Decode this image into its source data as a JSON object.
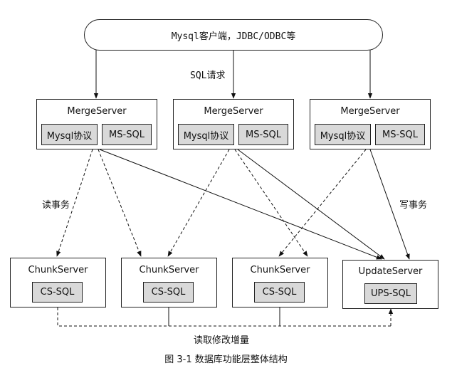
{
  "client": {
    "label": "Mysql客户端，JDBC/ODBC等"
  },
  "sql_request_label": "SQL请求",
  "merge_servers": [
    {
      "title": "MergeServer",
      "proto_label": "Mysql协议",
      "mssql_label": "MS-SQL"
    },
    {
      "title": "MergeServer",
      "proto_label": "Mysql协议",
      "mssql_label": "MS-SQL"
    },
    {
      "title": "MergeServer",
      "proto_label": "Mysql协议",
      "mssql_label": "MS-SQL"
    }
  ],
  "read_tx_label": "读事务",
  "write_tx_label": "写事务",
  "chunk_servers": [
    {
      "title": "ChunkServer",
      "sql_label": "CS-SQL"
    },
    {
      "title": "ChunkServer",
      "sql_label": "CS-SQL"
    },
    {
      "title": "ChunkServer",
      "sql_label": "CS-SQL"
    }
  ],
  "update_server": {
    "title": "UpdateServer",
    "sql_label": "UPS-SQL"
  },
  "read_increment_label": "读取修改增量",
  "caption": "图 3-1  数据库功能层整体结构"
}
